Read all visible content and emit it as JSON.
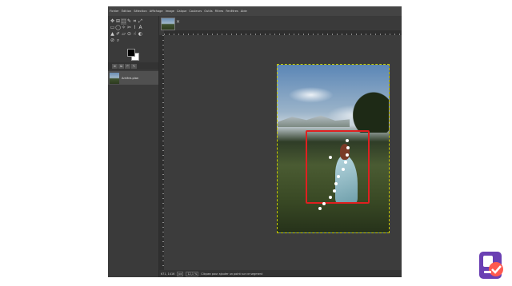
{
  "menu": [
    "Fichier",
    "Édition",
    "Sélection",
    "Affichage",
    "Image",
    "Calque",
    "Couleurs",
    "Outils",
    "Filtres",
    "Fenêtres",
    "Aide"
  ],
  "toolbox": {
    "tools": [
      {
        "name": "move-tool-icon",
        "glyph": "✥"
      },
      {
        "name": "align-tool-icon",
        "glyph": "⊞"
      },
      {
        "name": "free-select-icon",
        "glyph": "⬚"
      },
      {
        "name": "path-tool-icon",
        "glyph": "✎"
      },
      {
        "name": "crop-tool-icon",
        "glyph": "⌗"
      },
      {
        "name": "transform-tool-icon",
        "glyph": "⤢"
      },
      {
        "name": "rect-select-icon",
        "glyph": "▭"
      },
      {
        "name": "ellipse-select-icon",
        "glyph": "◯"
      },
      {
        "name": "fuzzy-select-icon",
        "glyph": "✧"
      },
      {
        "name": "scissors-icon",
        "glyph": "✂"
      },
      {
        "name": "paths-icon",
        "glyph": "⌇"
      },
      {
        "name": "text-tool-icon",
        "glyph": "A"
      },
      {
        "name": "bucket-fill-icon",
        "glyph": "▲"
      },
      {
        "name": "paintbrush-icon",
        "glyph": "✐"
      },
      {
        "name": "eraser-icon",
        "glyph": "▱"
      },
      {
        "name": "clone-tool-icon",
        "glyph": "⊙"
      },
      {
        "name": "smudge-icon",
        "glyph": "☝"
      },
      {
        "name": "dodge-burn-icon",
        "glyph": "◐"
      },
      {
        "name": "color-picker-icon",
        "glyph": "⊘"
      },
      {
        "name": "zoom-icon",
        "glyph": "⌕"
      }
    ]
  },
  "layers": {
    "tabs": [
      "≡",
      "⧉",
      "↶",
      "✎"
    ],
    "layer_name": "Arrière-plan",
    "footer_icons": [
      "⇱",
      "▣",
      "⊟"
    ]
  },
  "status": {
    "coords": "671, 1416",
    "unit": "px",
    "zoom": "12,1 %",
    "message": "Cliquez pour ajouter un point sur ce segment"
  },
  "tabs": {
    "close": "✕"
  },
  "colors": {
    "accent": "#e02020",
    "ui_bg": "#3b3b3b"
  },
  "path_point_count": 12
}
